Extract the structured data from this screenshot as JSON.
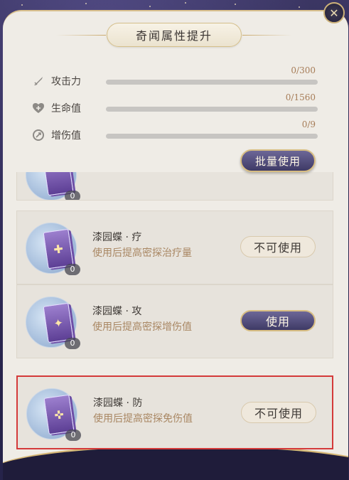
{
  "panel": {
    "title": "奇闻属性提升",
    "close_icon": "close-icon"
  },
  "stats": [
    {
      "label": "攻击力",
      "icon": "sword-icon",
      "value_text": "0/300",
      "progress": 0
    },
    {
      "label": "生命值",
      "icon": "heart-plus-icon",
      "value_text": "0/1560",
      "progress": 0
    },
    {
      "label": "增伤值",
      "icon": "damage-icon",
      "value_text": "0/9",
      "progress": 0
    }
  ],
  "batch_button": {
    "label": "批量使用"
  },
  "items": [
    {
      "count": "0"
    },
    {
      "name": "漆园蝶 · 疗",
      "desc": "使用后提高密探治疗量",
      "count": "0",
      "button": "不可使用",
      "button_state": "disabled"
    },
    {
      "name": "漆园蝶 · 攻",
      "desc": "使用后提高密探增伤值",
      "count": "0",
      "button": "使用",
      "button_state": "active"
    },
    {
      "name": "漆园蝶 · 防",
      "desc": "使用后提高密探免伤值",
      "count": "0",
      "button": "不可使用",
      "button_state": "disabled"
    }
  ],
  "colors": {
    "accent_gold": "#d7bd82",
    "button_purple": "#4f4a7a",
    "panel_bg": "#efece6",
    "selected_border": "#d43a3a"
  }
}
